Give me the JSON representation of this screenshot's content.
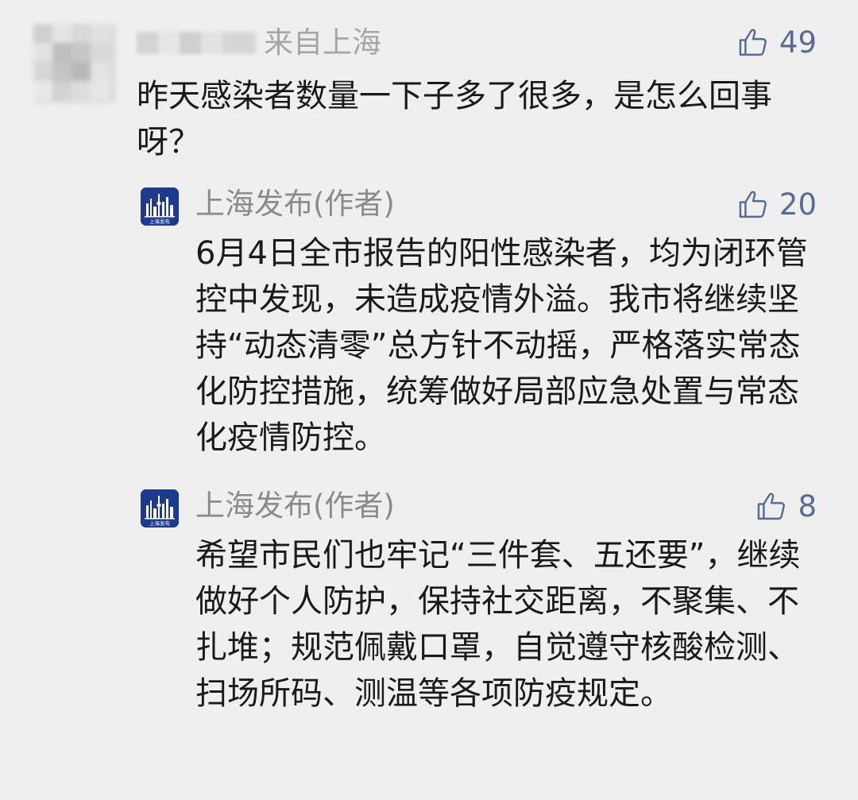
{
  "comment": {
    "location": "来自上海",
    "likes": "49",
    "text": "昨天感染者数量一下子多了很多，是怎么回事呀？"
  },
  "replies": [
    {
      "author": "上海发布(作者)",
      "avatar_label": "上海发布",
      "likes": "20",
      "text": "6月4日全市报告的阳性感染者，均为闭环管控中发现，未造成疫情外溢。我市将继续坚持“动态清零”总方针不动摇，严格落实常态化防控措施，统筹做好局部应急处置与常态化疫情防控。"
    },
    {
      "author": "上海发布(作者)",
      "avatar_label": "上海发布",
      "likes": "8",
      "text": "希望市民们也牢记“三件套、五还要”，继续做好个人防护，保持社交距离，不聚集、不扎堆；规范佩戴口罩，自觉遵守核酸检测、扫场所码、测温等各项防疫规定。"
    }
  ],
  "icons": {
    "like": "thumbs-up-icon"
  },
  "colors": {
    "background": "#efefef",
    "link_blue": "#576b95",
    "text": "#1a1a1a",
    "secondary_text": "#8a8a8a",
    "avatar_blue": "#1e3a8c"
  }
}
